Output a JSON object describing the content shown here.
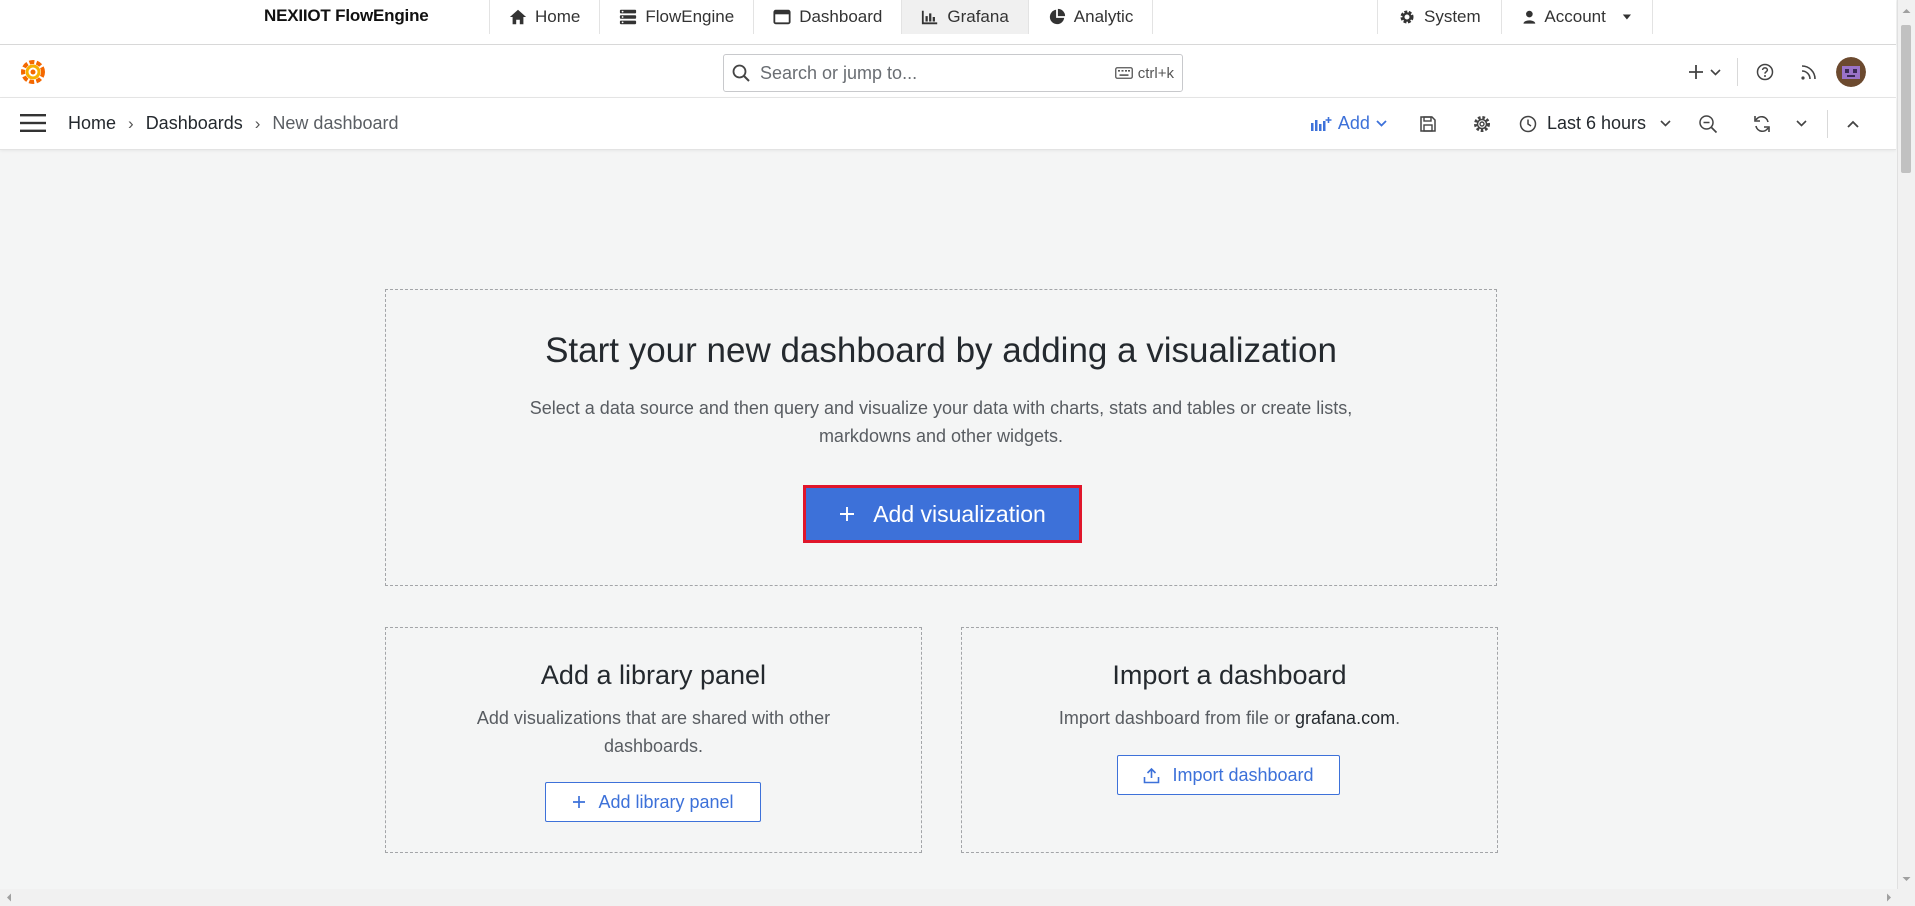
{
  "appbar": {
    "brand": "NEXIIOT FlowEngine",
    "nav_left": [
      {
        "label": "Home",
        "icon": "home-icon"
      },
      {
        "label": "FlowEngine",
        "icon": "server-icon"
      },
      {
        "label": "Dashboard",
        "icon": "window-icon"
      },
      {
        "label": "Grafana",
        "icon": "bar-chart-icon",
        "active": true
      },
      {
        "label": "Analytic",
        "icon": "pie-chart-icon"
      }
    ],
    "nav_right": [
      {
        "label": "System",
        "icon": "gear-icon"
      },
      {
        "label": "Account",
        "icon": "user-icon"
      }
    ]
  },
  "grafana_top": {
    "search_placeholder": "Search or jump to...",
    "shortcut": "ctrl+k"
  },
  "toolbar": {
    "breadcrumbs": [
      "Home",
      "Dashboards",
      "New dashboard"
    ],
    "add_label": "Add",
    "time_range": "Last 6 hours"
  },
  "main": {
    "title": "Start your new dashboard by adding a visualization",
    "description": "Select a data source and then query and visualize your data with charts, stats and tables or create lists, markdowns and other widgets.",
    "primary_button": "Add visualization"
  },
  "library": {
    "title": "Add a library panel",
    "description": "Add visualizations that are shared with other dashboards.",
    "button": "Add library panel"
  },
  "import": {
    "title": "Import a dashboard",
    "description_prefix": "Import dashboard from file or ",
    "description_link": "grafana.com",
    "description_suffix": ".",
    "button": "Import dashboard"
  },
  "colors": {
    "primary": "#3d71d9",
    "highlight_border": "#e0162b",
    "page_bg": "#f4f5f5"
  }
}
